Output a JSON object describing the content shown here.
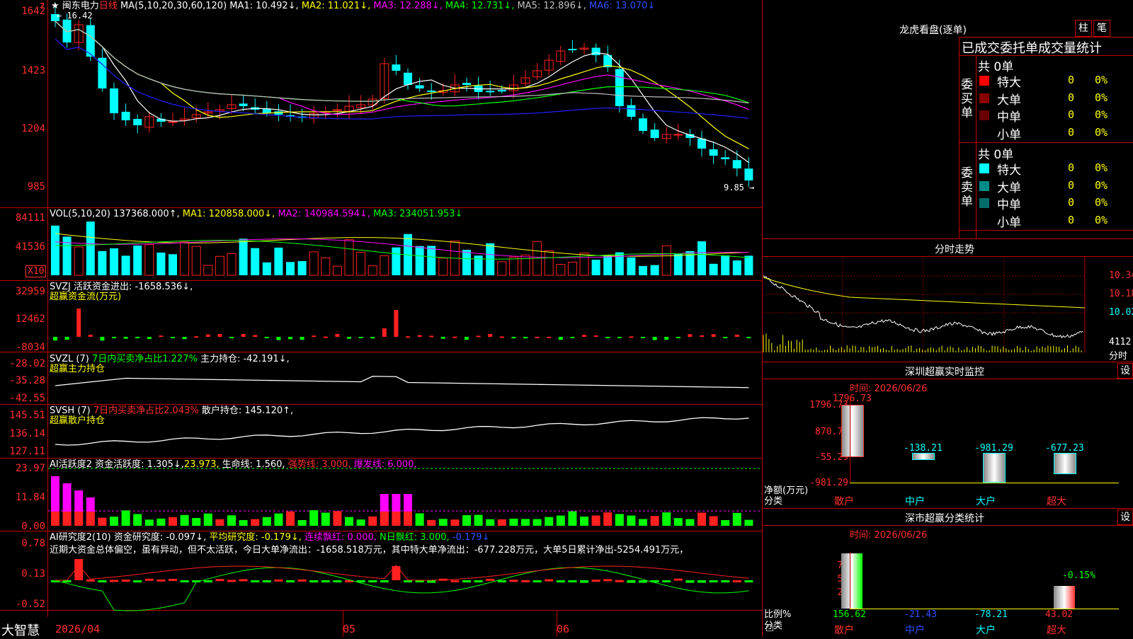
{
  "app": {
    "brand": "大智慧",
    "lock_icon": "lock-icon"
  },
  "header": {
    "star": "★",
    "stock": "闽东电力",
    "period": "日线",
    "ma_params": "MA(5,10,20,30,60,120)",
    "ma1": "MA1: 10.492↓,",
    "ma2": "MA2: 11.021↓,",
    "ma3": "MA3: 12.288↓,",
    "ma4": "MA4: 12.731↓,",
    "ma5": "MA5: 12.896↓,",
    "ma6": "MA6: 13.070↓",
    "high_marker": "16.42",
    "low_marker": "9.85",
    "colors": {
      "ma1": "#ffffff",
      "ma2": "#ffff00",
      "ma3": "#ff00ff",
      "ma4": "#00ff00",
      "ma5": "#c0c0c0",
      "ma6": "#2020ff"
    }
  },
  "price_axis": [
    "1642",
    "1423",
    "1204",
    "985"
  ],
  "volume": {
    "title": "VOL(5,10,20)",
    "value": "137368.000↑,",
    "ma1": "MA1: 120858.000↓,",
    "ma2": "MA2: 140984.594↓,",
    "ma3": "MA3: 234051.953↓",
    "axis": [
      "84111",
      "41536"
    ],
    "unit": "X10"
  },
  "svzj": {
    "title": "SVZJ",
    "label": "活跃资金进出: -1658.536↓,",
    "sub": "超赢资金流(万元)",
    "axis": [
      "32959",
      "12462",
      "-8034"
    ]
  },
  "svzl": {
    "title": "SVZL (7)",
    "ratio": "7日内买卖净占比1.227%",
    "label": "主力持仓: -42.191↓,",
    "sub": "超赢主力持仓",
    "axis": [
      "-28.02",
      "-35.28",
      "-42.55"
    ]
  },
  "svsh": {
    "title": "SVSH (7)",
    "ratio": "7日内买卖净占比2.043%",
    "label": "散户持仓: 145.120↑,",
    "sub": "超赢散户持仓",
    "axis": [
      "145.51",
      "136.14",
      "127.11"
    ]
  },
  "ai_active": {
    "title": "AI活跃度2",
    "l1": "资金活跃度: 1.305↓,",
    "l2": "23.973,",
    "l3": "生命线: 1.560,",
    "l4": "强势线: 3.000,",
    "l5": "爆发线: 6.000,",
    "axis": [
      "23.97",
      "11.84",
      "0.00"
    ]
  },
  "ai_research": {
    "title": "AI研究度2(10)",
    "l1": "资金研究度: -0.097↓,",
    "l2": "平均研究度: -0.179↓,",
    "l3": "连续飘红: 0.000,",
    "l4": "N日飘红: 3.000,",
    "l5": "-0.179↓",
    "commentary": "近期大资金总体偏空，虽有异动，但不太活跃，今日大单净流出：-1658.518万元，其中特大单净流出：-677.228万元，大单5日累计净出-5254.491万元，",
    "axis": [
      "0.78",
      "0.13",
      "-0.52"
    ]
  },
  "date_axis": [
    "2026/04",
    "05",
    "06"
  ],
  "longhu": {
    "title": "龙虎看盘(逐单)",
    "btn1": "柱",
    "btn2": "笔",
    "subtitle": "已成交委托单成交量统计",
    "buy_label": "委买单",
    "sell_label": "委卖单",
    "buy_total": "共 0单",
    "sell_total": "共 0单",
    "buy_rows": [
      {
        "name": "特大",
        "count": "0",
        "pct": "0%",
        "color": "#ff0000"
      },
      {
        "name": "大单",
        "count": "0",
        "pct": "0%",
        "color": "#8b0000"
      },
      {
        "name": "中单",
        "count": "0",
        "pct": "0%",
        "color": "#6b0000"
      },
      {
        "name": "小单",
        "count": "0",
        "pct": "0%",
        "color": "#000000"
      }
    ],
    "sell_rows": [
      {
        "name": "特大",
        "count": "0",
        "pct": "0%",
        "color": "#00ffff"
      },
      {
        "name": "大单",
        "count": "0",
        "pct": "0%",
        "color": "#008b8b"
      },
      {
        "name": "中单",
        "count": "0",
        "pct": "0%",
        "color": "#006b6b"
      },
      {
        "name": "小单",
        "count": "0",
        "pct": "0%",
        "color": "#000000"
      }
    ]
  },
  "intraday": {
    "title": "分时走势",
    "axis": [
      "10.34",
      "10.18",
      "10.02"
    ],
    "vol": "4112",
    "vol_label": "分时"
  },
  "monitor": {
    "title": "深圳超赢实时监控",
    "settings": "设",
    "time": "时间: 2026/06/26",
    "axis": [
      "1796.73",
      "870.72",
      "-55.29",
      "-981.29"
    ],
    "ylabel1": "净额(万元)",
    "ylabel2": "分类",
    "bars": [
      {
        "name": "散户",
        "value": "1796.73"
      },
      {
        "name": "中户",
        "value": "-138.21"
      },
      {
        "name": "大户",
        "value": "-981.29"
      },
      {
        "name": "超大",
        "value": "-677.23"
      }
    ]
  },
  "classify": {
    "title": "深市超赢分类统计",
    "settings": "设",
    "time": "时间: 2026/06/26",
    "axis": [
      "75",
      "50",
      "25",
      "0"
    ],
    "ylabel1": "比例%",
    "ylabel2": "分类",
    "top_label": "-0.15%",
    "bars": [
      {
        "name": "散户",
        "value": "156.62"
      },
      {
        "name": "中户",
        "value": "-21.43"
      },
      {
        "name": "大户",
        "value": "-78.21"
      },
      {
        "name": "超大",
        "value": "43.02"
      }
    ]
  }
}
